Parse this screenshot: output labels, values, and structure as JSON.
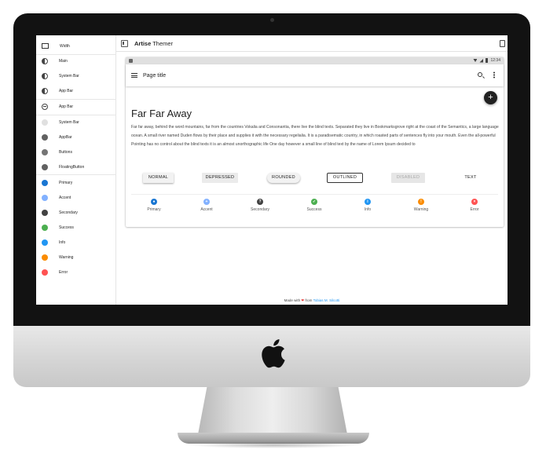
{
  "sidebar": {
    "items": [
      {
        "label": "Width",
        "icon": "desktop-icon",
        "color": "#333333"
      },
      {
        "label": "Main",
        "icon": "contrast-icon",
        "color": "#444444"
      },
      {
        "label": "System Bar",
        "icon": "contrast-icon",
        "color": "#444444"
      },
      {
        "label": "App Bar",
        "icon": "contrast-icon",
        "color": "#444444"
      },
      {
        "label": "App Bar",
        "icon": "add-circle-icon",
        "color": "#444444"
      },
      {
        "label": "System Bar",
        "icon": "color-swatch-icon",
        "color": "#e0e0e0"
      },
      {
        "label": "AppBar",
        "icon": "color-swatch-icon",
        "color": "#616161"
      },
      {
        "label": "Buttons",
        "icon": "color-swatch-icon",
        "color": "#757575"
      },
      {
        "label": "FloatingButton",
        "icon": "color-swatch-icon",
        "color": "#616161"
      },
      {
        "label": "Primary",
        "icon": "color-swatch-icon",
        "color": "#1976d2"
      },
      {
        "label": "Accent",
        "icon": "color-swatch-icon",
        "color": "#82b1ff"
      },
      {
        "label": "Secondary",
        "icon": "color-swatch-icon",
        "color": "#424242"
      },
      {
        "label": "Success",
        "icon": "color-swatch-icon",
        "color": "#4caf50"
      },
      {
        "label": "Info",
        "icon": "color-swatch-icon",
        "color": "#2196f3"
      },
      {
        "label": "Warning",
        "icon": "color-swatch-icon",
        "color": "#fb8c00"
      },
      {
        "label": "Error",
        "icon": "color-swatch-icon",
        "color": "#ff5252"
      }
    ]
  },
  "topbar": {
    "title_bold": "Artise",
    "title_rest": " Themer"
  },
  "preview": {
    "status_time": "12:34",
    "page_title": "Page title",
    "fab_label": "+",
    "headline": "Far Far Away",
    "body": "Far far away, behind the word mountains, far from the countries Vokalia and Consonantia, there live the blind texts. Separated they live in Bookmarksgrove right at the coast of the Semantics, a large language ocean. A small river named Duden flows by their place and supplies it with the necessary regelialia. It is a paradisematic country, in which roasted parts of sentences fly into your mouth. Even the all-powerful Pointing has no control about the blind texts it is an almost unorthographic life One day however a small line of blind text by the name of Lorem Ipsum decided to",
    "buttons": {
      "normal": "NORMAL",
      "depressed": "DEPRESSED",
      "rounded": "ROUNDED",
      "outlined": "OUTLINED",
      "disabled": "DISABLED",
      "text": "TEXT"
    },
    "badges": [
      {
        "label": "Primary",
        "color": "#1976d2",
        "glyph": "●"
      },
      {
        "label": "Accent",
        "color": "#82b1ff",
        "glyph": "+"
      },
      {
        "label": "Secondary",
        "color": "#424242",
        "glyph": "?"
      },
      {
        "label": "Success",
        "color": "#4caf50",
        "glyph": "✓"
      },
      {
        "label": "Info",
        "color": "#2196f3",
        "glyph": "i"
      },
      {
        "label": "Warning",
        "color": "#fb8c00",
        "glyph": "!"
      },
      {
        "label": "Error",
        "color": "#ff5252",
        "glyph": "×"
      }
    ]
  },
  "footer": {
    "prefix": "Made with ",
    "heart": "❤",
    "middle": " from ",
    "author": "Tobias M. Silcotti"
  }
}
